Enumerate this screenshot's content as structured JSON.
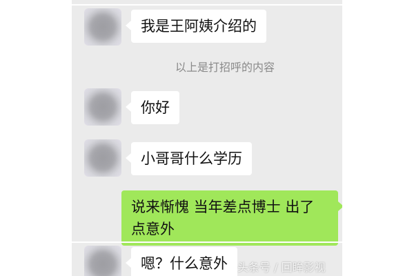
{
  "chat": {
    "messages": [
      {
        "side": "left",
        "text": "我是王阿姨介绍的"
      },
      {
        "side": "system",
        "text": "以上是打招呼的内容"
      },
      {
        "side": "left",
        "text": "你好"
      },
      {
        "side": "left",
        "text": "小哥哥什么学历"
      },
      {
        "side": "right",
        "text": "说来惭愧 当年差点博士 出了点意外"
      },
      {
        "side": "left",
        "text": "嗯？什么意外"
      }
    ]
  },
  "watermark": "头条号 / 回眸影视",
  "colors": {
    "background": "#ebebeb",
    "received_bubble": "#ffffff",
    "sent_bubble": "#a0e75a",
    "system_text": "#8a8a8a"
  },
  "icons": [
    "avatar-blurred",
    "avatar-blurred",
    "avatar-blurred",
    "avatar-blurred"
  ]
}
